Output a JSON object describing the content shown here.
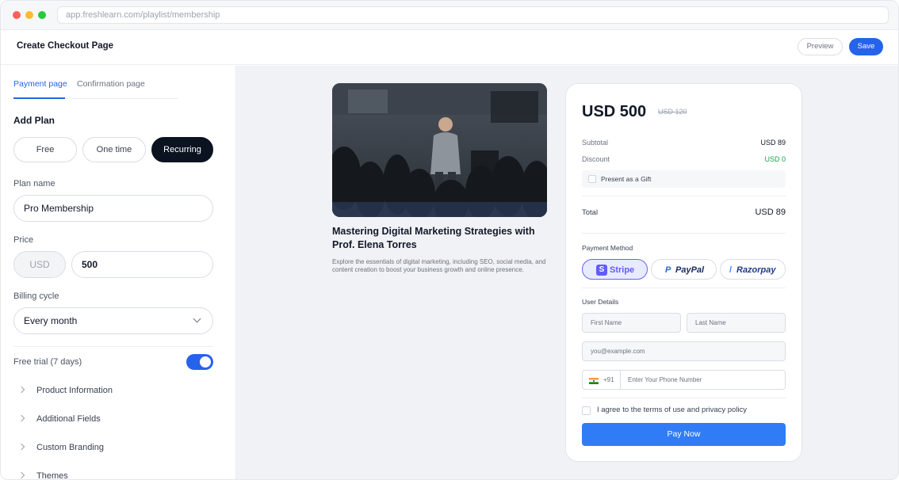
{
  "browser": {
    "url": "app.freshlearn.com/playlist/membership"
  },
  "header": {
    "title": "Create Checkout Page",
    "preview_label": "Preview",
    "save_label": "Save"
  },
  "sidebar": {
    "tabs": [
      {
        "label": "Payment page"
      },
      {
        "label": "Confirmation page"
      }
    ],
    "add_plan_title": "Add Plan",
    "plan_types": [
      {
        "label": "Free"
      },
      {
        "label": "One time"
      },
      {
        "label": "Recurring"
      }
    ],
    "plan_name": {
      "label": "Plan name",
      "value": "Pro Membership"
    },
    "price": {
      "label": "Price",
      "currency": "USD",
      "value": "500"
    },
    "billing_cycle": {
      "label": "Billing cycle",
      "value": "Every month"
    },
    "free_trial": {
      "label": "Free trial (7 days)",
      "enabled": true
    },
    "accordion": [
      {
        "label": "Product Information"
      },
      {
        "label": "Additional Fields"
      },
      {
        "label": "Custom Branding"
      },
      {
        "label": "Themes"
      }
    ]
  },
  "course": {
    "title": "Mastering Digital Marketing Strategies with Prof. Elena Torres",
    "description": "Explore the essentials of digital marketing, including SEO, social media, and content creation to boost your business growth and online presence."
  },
  "checkout": {
    "price": "USD 500",
    "old_price": "USD 120",
    "subtotal": {
      "label": "Subtotal",
      "value": "USD 89"
    },
    "discount": {
      "label": "Discount",
      "value": "USD 0"
    },
    "gift_label": "Present as a Gift",
    "total": {
      "label": "Total",
      "value": "USD 89"
    },
    "payment_method_title": "Payment Method",
    "payment_methods": [
      {
        "label": "Stripe"
      },
      {
        "label": "PayPal"
      },
      {
        "label": "Razorpay"
      }
    ],
    "user_details_title": "User Details",
    "first_name_placeholder": "First Name",
    "last_name_placeholder": "Last Name",
    "email_placeholder": "you@example.com",
    "phone_code": "+91",
    "phone_placeholder": "Enter Your Phone Number",
    "agree_label": "I agree to the terms of use and privacy policy",
    "pay_label": "Pay Now"
  },
  "colors": {
    "accent": "#2563eb",
    "dark_pill": "#0b1220",
    "discount_green": "#16a34a",
    "pay_button": "#2f7cf6"
  }
}
